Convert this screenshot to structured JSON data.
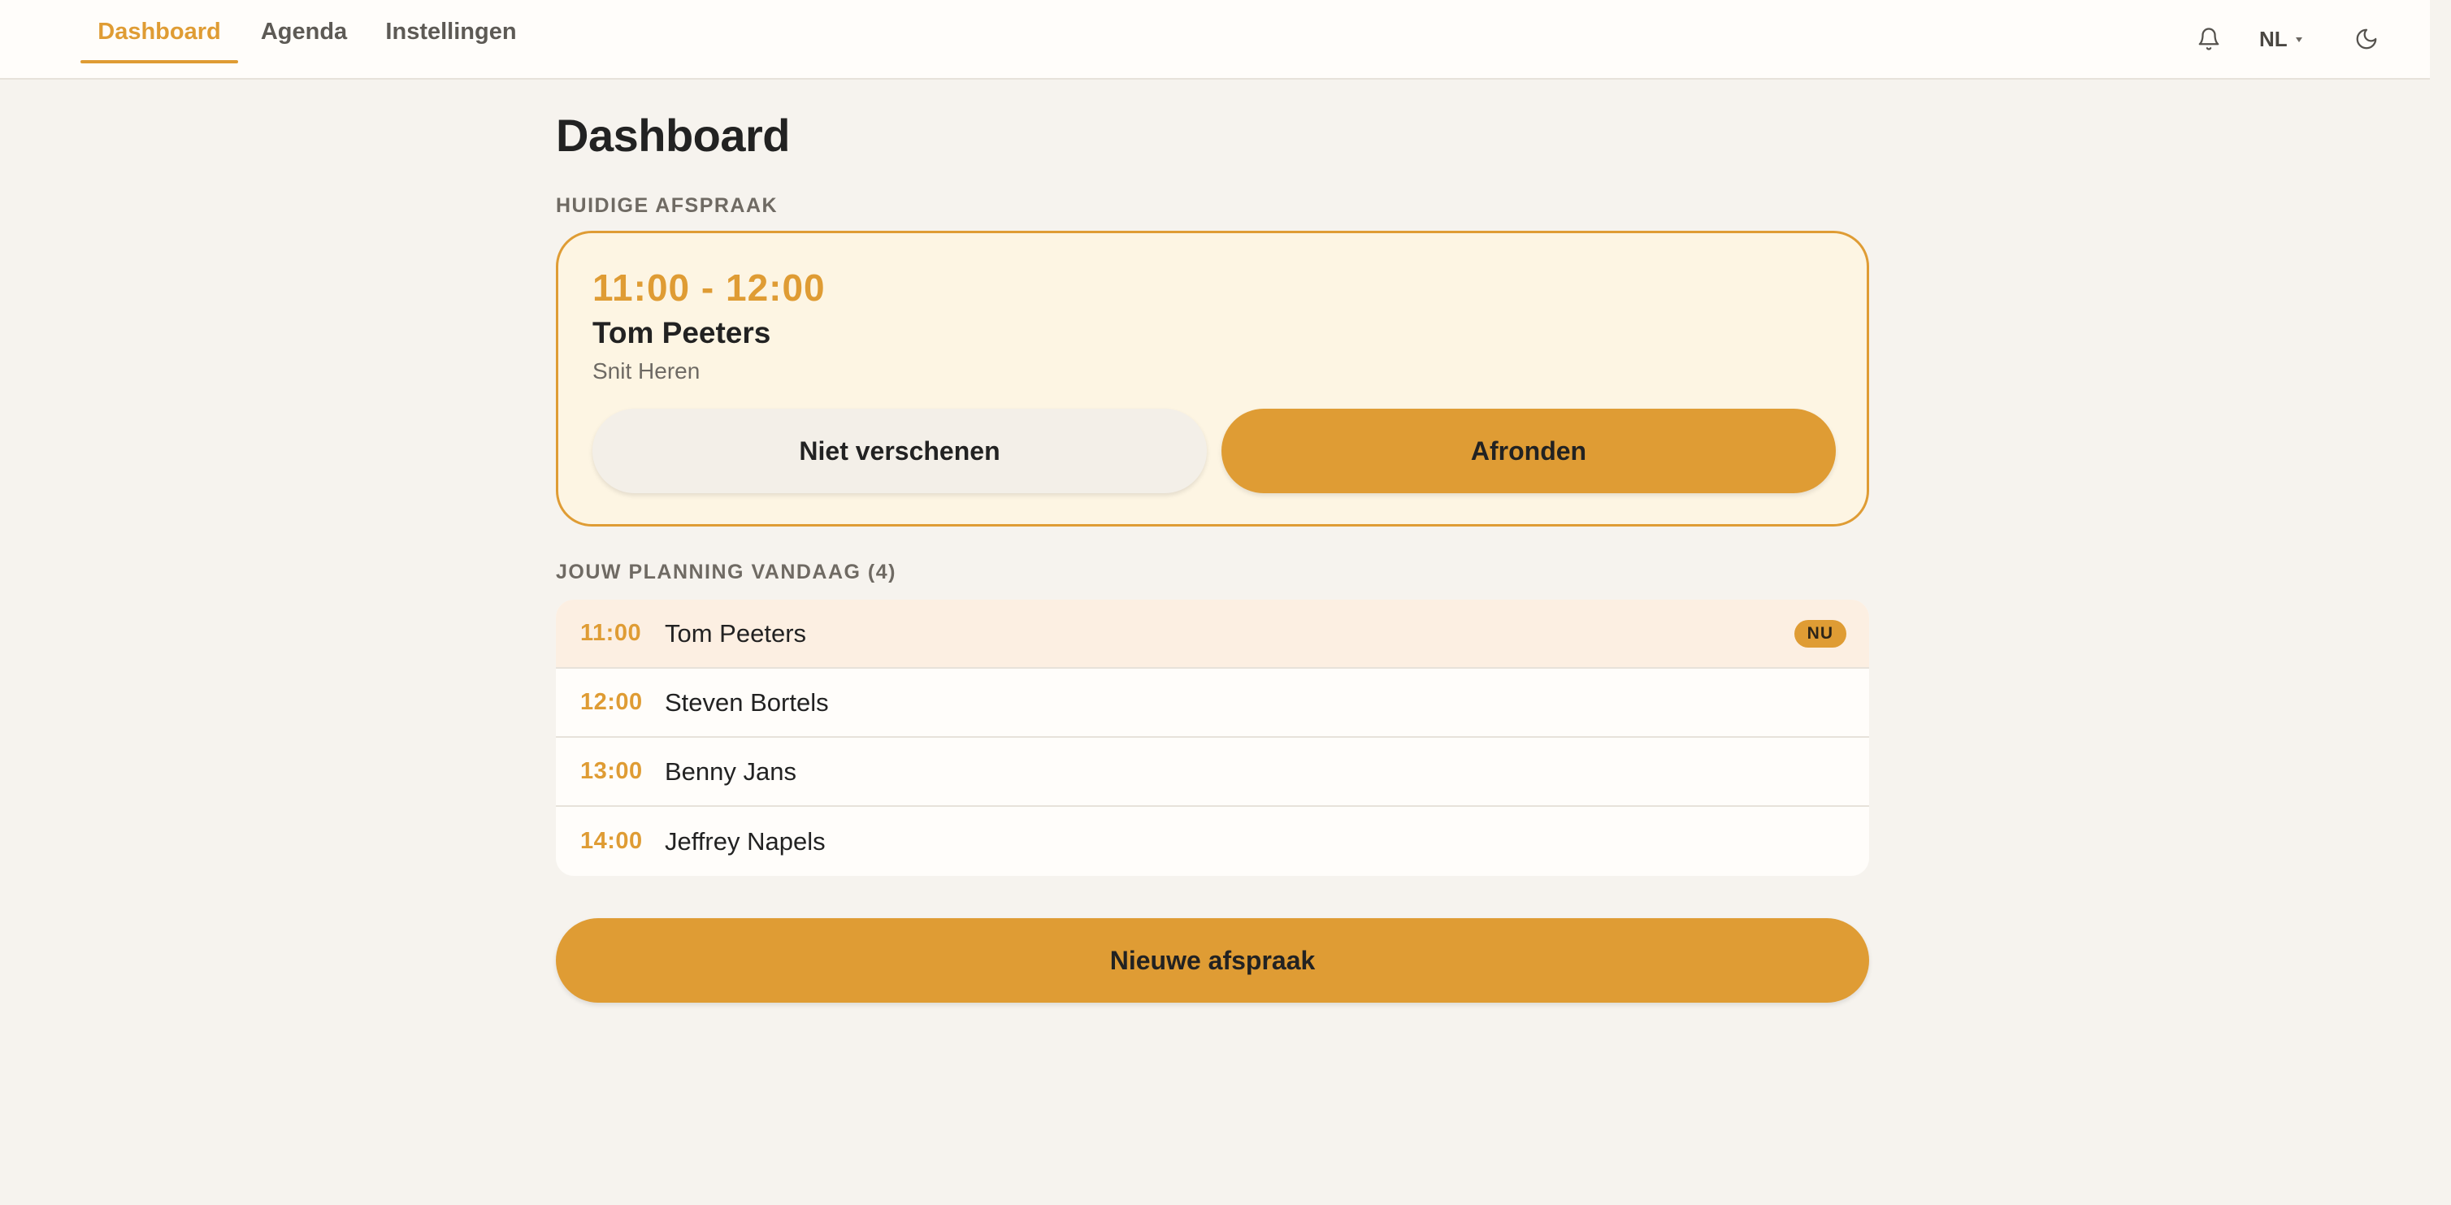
{
  "nav": {
    "tabs": [
      {
        "label": "Dashboard",
        "active": true
      },
      {
        "label": "Agenda",
        "active": false
      },
      {
        "label": "Instellingen",
        "active": false
      }
    ],
    "language": "NL",
    "icons": {
      "notifications": "bell-icon",
      "theme": "moon-icon",
      "language_caret": "caret-down-icon"
    }
  },
  "page": {
    "title": "Dashboard"
  },
  "current": {
    "section_label": "HUIDIGE AFSPRAAK",
    "time": "11:00 - 12:00",
    "client": "Tom Peeters",
    "service": "Snit Heren",
    "no_show_label": "Niet verschenen",
    "finish_label": "Afronden"
  },
  "schedule": {
    "section_label": "JOUW PLANNING VANDAAG (4)",
    "items": [
      {
        "time": "11:00",
        "name": "Tom Peeters",
        "badge": "NU"
      },
      {
        "time": "12:00",
        "name": "Steven Bortels"
      },
      {
        "time": "13:00",
        "name": "Benny Jans"
      },
      {
        "time": "14:00",
        "name": "Jeffrey Napels"
      }
    ]
  },
  "actions": {
    "new_appointment_label": "Nieuwe afspraak"
  },
  "colors": {
    "accent": "#df9c34",
    "background": "#f6f3ee",
    "card_background": "#fdf5e3",
    "current_row_background": "#fcefe2"
  }
}
